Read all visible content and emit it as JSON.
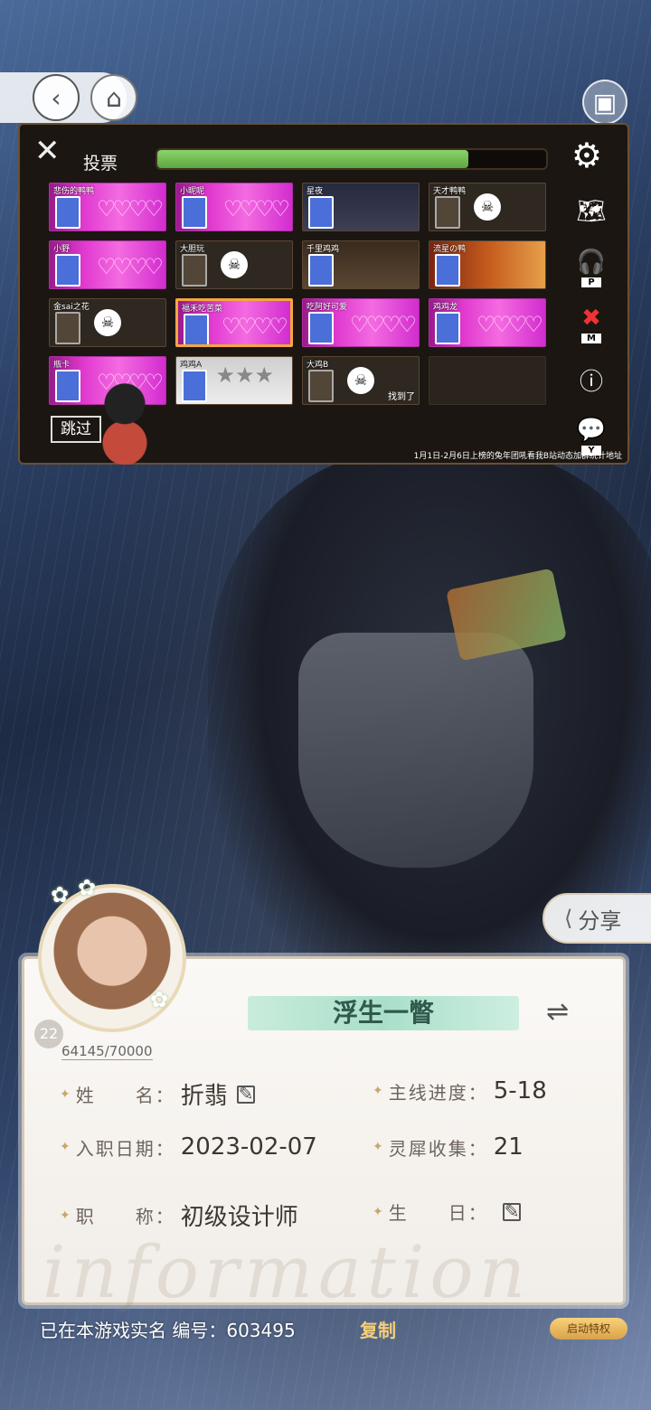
{
  "nav": {
    "back_icon": "back-arrow-icon",
    "home_icon": "home-icon",
    "gallery_icon": "gallery-icon"
  },
  "game": {
    "title": "投票",
    "progress": 0.8,
    "skip_label": "跳过",
    "footer_text": "1月1日-2月6日上榜的兔年团吼看我B站动态加群统计地址",
    "right_icons": [
      {
        "name": "map-icon",
        "key": ""
      },
      {
        "name": "headphones-icon",
        "key": "P"
      },
      {
        "name": "mute-icon",
        "key": "M"
      },
      {
        "name": "info-icon",
        "key": ""
      },
      {
        "name": "chat-icon",
        "key": "Y"
      }
    ],
    "cards": [
      {
        "name": "悲伤的鸭鸭",
        "style": "pink",
        "state": "unlocked"
      },
      {
        "name": "小昵呢",
        "style": "pink",
        "state": "unlocked"
      },
      {
        "name": "星夜",
        "style": "night",
        "state": "unlocked"
      },
      {
        "name": "天才鸭鸭",
        "style": "dark",
        "state": "locked"
      },
      {
        "name": "小野",
        "style": "pink",
        "state": "unlocked"
      },
      {
        "name": "大胆玩",
        "style": "dark",
        "state": "locked"
      },
      {
        "name": "千里鸡鸡",
        "style": "food",
        "state": "unlocked"
      },
      {
        "name": "流星の鸭",
        "style": "fire",
        "state": "unlocked"
      },
      {
        "name": "金sai之花",
        "style": "dark",
        "state": "locked"
      },
      {
        "name": "福禾吃苦菜",
        "style": "pink",
        "state": "unlocked",
        "highlight": true
      },
      {
        "name": "吃阿好可爱",
        "style": "pink",
        "state": "unlocked"
      },
      {
        "name": "鸡鸡龙",
        "style": "pink",
        "state": "unlocked"
      },
      {
        "name": "瓶卡",
        "style": "pink",
        "state": "unlocked"
      },
      {
        "name": "鸡鸡A",
        "style": "stars",
        "state": "unlocked"
      },
      {
        "name": "大鸡B",
        "style": "dark",
        "state": "locked",
        "found": "找到了"
      },
      {
        "name": "",
        "style": "empty",
        "state": "empty"
      }
    ]
  },
  "share": {
    "label": "分享",
    "icon": "share-icon"
  },
  "profile": {
    "level": "22",
    "exp": "64145/70000",
    "title_badge": "浮生一瞥",
    "watermark": "information",
    "fields": {
      "name_label": "姓　　名：",
      "name_value": "折翡",
      "progress_label": "主线进度：",
      "progress_value": "5-18",
      "join_label": "入职日期：",
      "join_value": "2023-02-07",
      "collect_label": "灵犀收集：",
      "collect_value": "21",
      "job_label": "职　　称：",
      "job_value": "初级设计师",
      "birthday_label": "生　　日：",
      "birthday_value": ""
    }
  },
  "bottom": {
    "verified_text": "已在本游戏实名  编号：603495",
    "copy_label": "复制",
    "privilege_label": "启动特权"
  }
}
